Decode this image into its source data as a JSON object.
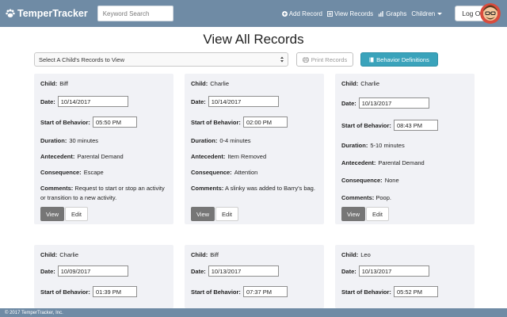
{
  "navbar": {
    "brand": "TemperTracker",
    "search_placeholder": "Keyword Search",
    "links": {
      "add_record": "Add Record",
      "view_records": "View Records",
      "graphs": "Graphs",
      "children": "Children"
    },
    "logout": "Log Out"
  },
  "header": {
    "title": "View All Records",
    "select_label": "Select A Child's Records to View",
    "print_button": "Print Records",
    "definitions_button": "Behavior Definitions"
  },
  "labels": {
    "child": "Child:",
    "date": "Date:",
    "start": "Start of Behavior:",
    "duration": "Duration:",
    "antecedent": "Antecedent:",
    "consequence": "Consequence:",
    "comments": "Comments:",
    "view": "View",
    "edit": "Edit"
  },
  "records": [
    {
      "child": "Biff",
      "date": "10/14/2017",
      "start": "05:50 PM",
      "duration": "30 minutes",
      "antecedent": "Parental Demand",
      "consequence": "Escape",
      "comments": "Request to start or stop an activity or transition to a new activity."
    },
    {
      "child": "Charlie",
      "date": "10/14/2017",
      "start": "02:00 PM",
      "duration": "0-4 minutes",
      "antecedent": "Item Removed",
      "consequence": "Attention",
      "comments": "A slinky was added to Barry's bag."
    },
    {
      "child": "Charlie",
      "date": "10/13/2017",
      "start": "08:43 PM",
      "duration": "5-10 minutes",
      "antecedent": "Parental Demand",
      "consequence": "None",
      "comments": "Poop."
    },
    {
      "child": "Charlie",
      "date": "10/09/2017",
      "start": "01:39 PM"
    },
    {
      "child": "Biff",
      "date": "10/13/2017",
      "start": "07:37 PM"
    },
    {
      "child": "Leo",
      "date": "10/13/2017",
      "start": "05:52 PM"
    }
  ],
  "footer": {
    "text": "© 2017 TemperTracker, Inc."
  }
}
